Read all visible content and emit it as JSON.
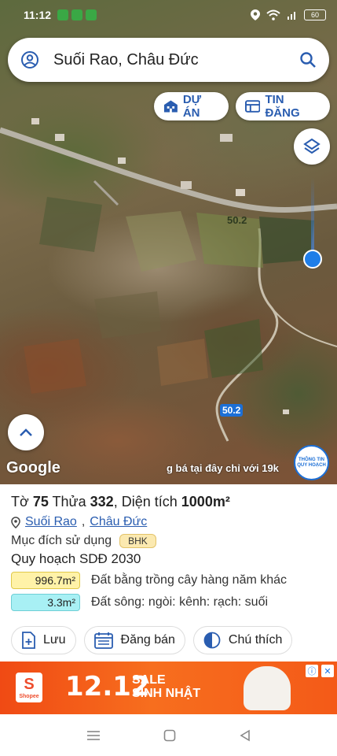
{
  "status_bar": {
    "time": "11:12",
    "battery": "60"
  },
  "search": {
    "title": "Suối Rao, Châu Đức"
  },
  "chips": {
    "du_an": "DỰ ÁN",
    "tin_dang": "TIN ĐĂNG"
  },
  "map": {
    "plot_number_label": "50.2",
    "lot_area_label": "50.2",
    "attribution": "Google",
    "promo_ticker": "g bá tại đây chỉ với 19k",
    "badge_line1": "THÔNG TIN",
    "badge_line2": "QUY HOẠCH"
  },
  "parcel": {
    "to_label": "Tờ",
    "to_value": "75",
    "thua_label": "Thửa",
    "thua_value": "332",
    "dt_label": "Diện tích",
    "dt_value": "1000m²",
    "commune": "Suối Rao",
    "district": "Châu Đức",
    "purpose_label": "Mục đích sử dụng",
    "purpose_code": "BHK",
    "plan_label": "Quy hoạch SDĐ 2030",
    "land_uses": [
      {
        "area": "996.7m²",
        "desc": "Đất bằng trồng cây hàng năm khác",
        "color": "#fff2a8",
        "border": "#e0c94a"
      },
      {
        "area": "3.3m²",
        "desc": "Đất sông: ngòi: kênh: rạch: suối",
        "color": "#a8f0f4",
        "border": "#6fcfd6"
      }
    ]
  },
  "actions": {
    "save": "Lưu",
    "post": "Đăng bán",
    "legend": "Chú thích"
  },
  "ad": {
    "brand": "Shopee",
    "headline": "12.12",
    "sale_line1": "SALE",
    "sale_line2": "SINH NHẬT"
  },
  "colors": {
    "accent": "#2a5db0",
    "loc_dot": "#1f7ee8",
    "ad_bg": "#f04a14"
  }
}
